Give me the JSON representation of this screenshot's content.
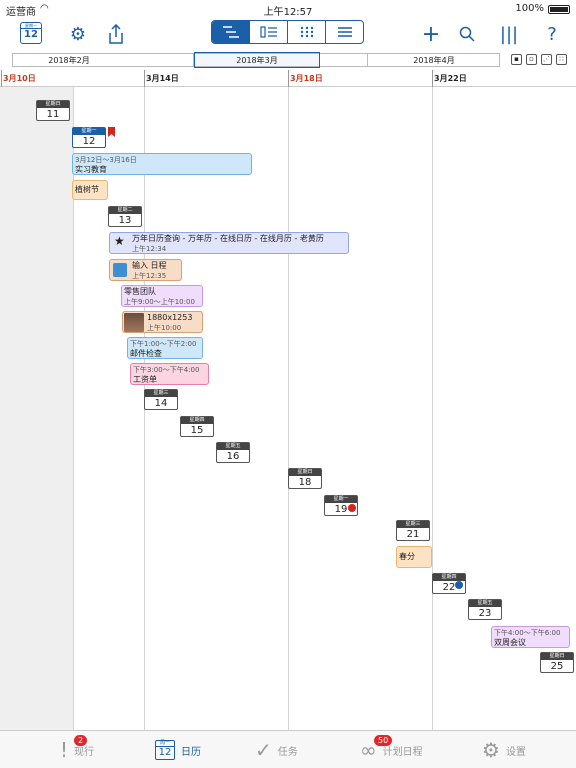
{
  "status": {
    "carrier": "运营商",
    "time": "上午12:57",
    "battery": "100%"
  },
  "toolbar": {
    "today_weekday": "星期一",
    "today_num": "12",
    "plus": "+",
    "search": "⌕",
    "columns": "|||",
    "help": "?"
  },
  "monthbar": {
    "feb": "2018年2月",
    "mar": "2018年3月",
    "apr": "2018年4月"
  },
  "ruler": {
    "d10": "3月10日",
    "d14": "3月14日",
    "d18": "3月18日",
    "d22": "3月22日"
  },
  "days": [
    {
      "wd": "星期日",
      "n": "11"
    },
    {
      "wd": "星期一",
      "n": "12"
    },
    {
      "wd": "星期二",
      "n": "13"
    },
    {
      "wd": "星期三",
      "n": "14"
    },
    {
      "wd": "星期四",
      "n": "15"
    },
    {
      "wd": "星期五",
      "n": "16"
    },
    {
      "wd": "星期日",
      "n": "18"
    },
    {
      "wd": "星期一",
      "n": "19"
    },
    {
      "wd": "星期三",
      "n": "21"
    },
    {
      "wd": "星期四",
      "n": "22"
    },
    {
      "wd": "星期五",
      "n": "23"
    },
    {
      "wd": "星期日",
      "n": "25"
    }
  ],
  "events": {
    "e1_range": "3月12日～3月16日",
    "e1_title": "实习教育",
    "e2_title": "植树节",
    "e3_title": "万年日历查询 - 万年历 - 在线日历 - 在线月历 - 老黄历",
    "e3_time": "上午12:34",
    "e4_title": "输入 日程",
    "e4_time": "上午12:35",
    "e5_title": "零售团队",
    "e5_time": "上午9:00～上午10:00",
    "e6_title": "1880x1253",
    "e6_time": "上午10:00",
    "e7_time": "下午1:00～下午2:00",
    "e7_title": "邮件检查",
    "e8_time": "下午3:00～下午4:00",
    "e8_title": "工资单",
    "e9_title": "春分",
    "e10_time": "下午4:00～下午6:00",
    "e10_title": "双周会议"
  },
  "tabs": {
    "current": "现行",
    "current_badge": "2",
    "calendar": "日历",
    "calendar_icon_top": "周一",
    "calendar_icon_num": "12",
    "tasks": "任务",
    "plans": "计划日程",
    "plans_badge": "50",
    "settings": "设置"
  }
}
